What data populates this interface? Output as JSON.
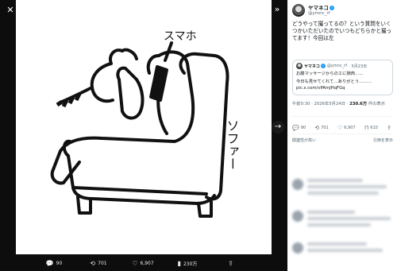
{
  "viewer": {
    "close_icon": "close-icon",
    "collapse_icon": "chevron-double-right-icon",
    "next_icon": "arrow-right-icon",
    "drawing_labels": {
      "phone": "スマホ",
      "sofa": "ソファー"
    },
    "actions": [
      {
        "icon": "reply-icon",
        "count": "90"
      },
      {
        "icon": "repost-icon",
        "count": "701"
      },
      {
        "icon": "like-icon",
        "count": "6,907"
      },
      {
        "icon": "views-icon",
        "count": "230万"
      },
      {
        "icon": "share-icon",
        "count": ""
      }
    ]
  },
  "tweet": {
    "author_name": "ヤマネコ",
    "author_handle": "@ymnc_rf",
    "text": "どうやって撮ってるの？という質問をいくつかいただいたのでいつもどちらかと撮ってます！今回は左",
    "quote": {
      "author_name": "ヤマネコ",
      "author_handle": "@ymnc_rf",
      "date": "5月23日",
      "line1": "お膝マッサージからのエに損肉……",
      "line2": "今日も見せてくれて…ありがとう………",
      "link": "pic.x.com/vPAmJHqFGq"
    },
    "time": "午前0:30 · 2026年5月24日 · ",
    "views_count": "230.6万",
    "views_label": " 件の表示",
    "actions": [
      {
        "icon": "reply-icon",
        "count": "90"
      },
      {
        "icon": "repost-icon",
        "count": "701"
      },
      {
        "icon": "like-icon",
        "count": "6,907"
      },
      {
        "icon": "bookmark-icon",
        "count": "610"
      },
      {
        "icon": "share-icon",
        "count": ""
      }
    ],
    "sort_label": "関連性が高い",
    "quote_posts_label": "引用を表示"
  },
  "colors": {
    "accent": "#1d9bf0",
    "panel_bg": "#ffffff",
    "viewer_bg": "#0d0d0d"
  }
}
